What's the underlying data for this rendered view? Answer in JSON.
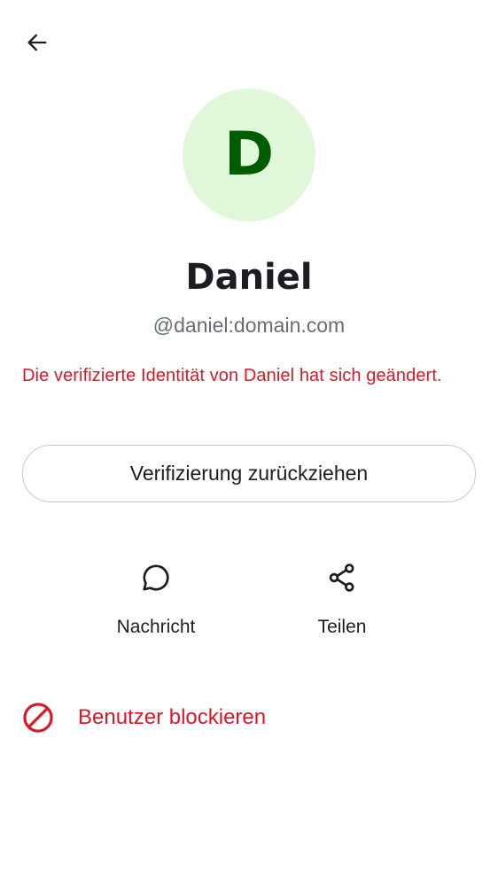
{
  "header": {
    "back_icon": "arrow-left-icon"
  },
  "profile": {
    "avatar_letter": "D",
    "display_name": "Daniel",
    "user_id": "@daniel:domain.com",
    "colors": {
      "avatar_bg": "#e0f8d9",
      "avatar_fg": "#005c00"
    }
  },
  "warning": {
    "text": "Die verifizierte Identität von Daniel hat sich geändert.",
    "color": "#d51928"
  },
  "withdraw_button": {
    "label": "Verifizierung zurückziehen"
  },
  "actions": [
    {
      "label": "Nachricht",
      "icon": "chat-bubble-icon"
    },
    {
      "label": "Teilen",
      "icon": "share-icon"
    }
  ],
  "block": {
    "label": "Benutzer blockieren",
    "icon": "block-icon",
    "color": "#d51928"
  }
}
